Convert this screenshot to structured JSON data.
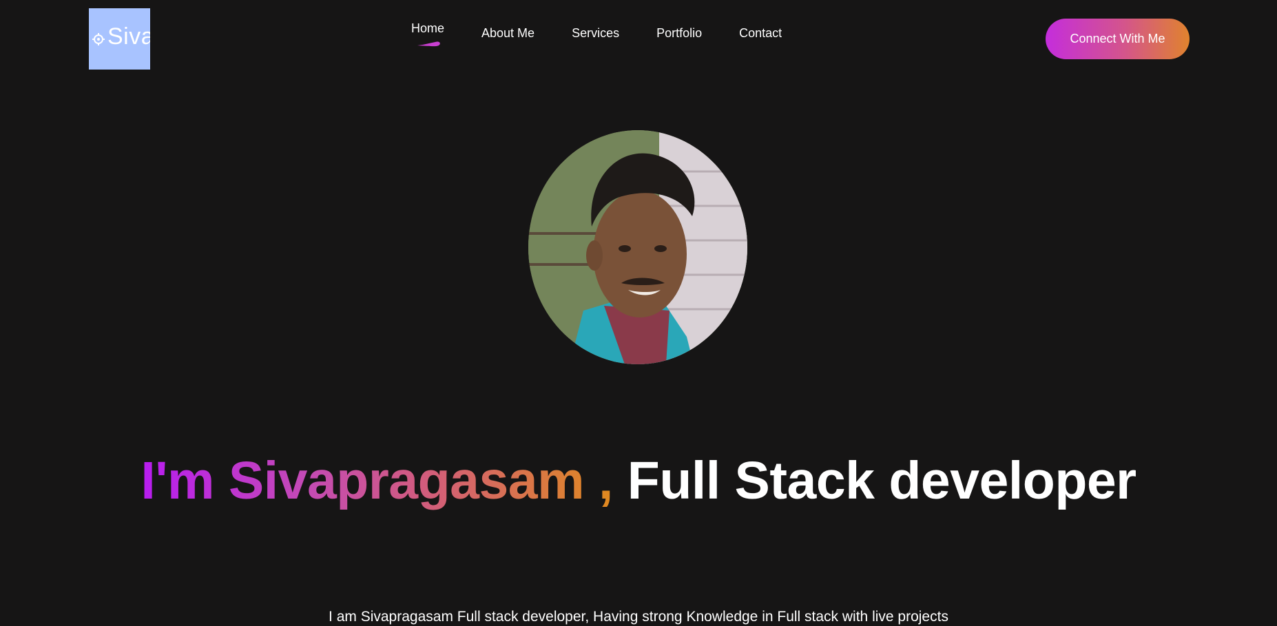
{
  "logo": {
    "text": "Siva",
    "icon": "gear-icon",
    "bg_color": "#a8c3ff"
  },
  "nav": {
    "items": [
      {
        "label": "Home",
        "active": true
      },
      {
        "label": "About Me",
        "active": false
      },
      {
        "label": "Services",
        "active": false
      },
      {
        "label": "Portfolio",
        "active": false
      },
      {
        "label": "Contact",
        "active": false
      }
    ],
    "underline_icon": "active-indicator-icon"
  },
  "cta": {
    "label": "Connect With Me"
  },
  "hero": {
    "greeting": "I'm Sivapragasam ,",
    "role": "Full Stack developer",
    "description": "I am Sivapragasam Full stack developer, Having strong Knowledge in Full stack with live projects"
  },
  "colors": {
    "background": "#161515",
    "accent_purple": "#b81cf0",
    "accent_orange": "#e08a1e",
    "button_start": "#c42ddc",
    "button_end": "#e0832d"
  }
}
